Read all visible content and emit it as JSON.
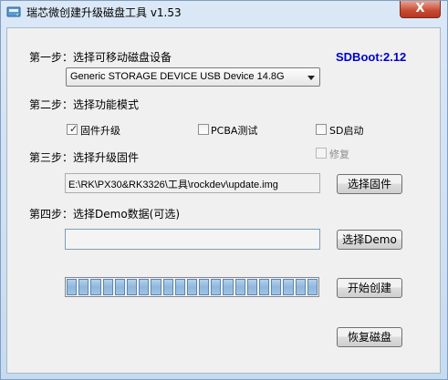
{
  "window": {
    "title": "瑞芯微创建升级磁盘工具 v1.53",
    "close_label": "X"
  },
  "version": "SDBoot:2.12",
  "step1": {
    "label": "第一步：选择可移动磁盘设备",
    "device": "Generic STORAGE DEVICE USB Device   14.8G"
  },
  "step2": {
    "label": "第二步：选择功能模式",
    "options": [
      {
        "label": "固件升级",
        "checked": true,
        "enabled": true
      },
      {
        "label": "PCBA测试",
        "checked": false,
        "enabled": true
      },
      {
        "label": "SD启动",
        "checked": false,
        "enabled": true
      },
      {
        "label": "修复",
        "checked": false,
        "enabled": false
      }
    ]
  },
  "step3": {
    "label": "第三步：选择升级固件",
    "path": "E:\\RK\\PX30&RK3326\\工具\\rockdev\\update.img",
    "button": "选择固件"
  },
  "step4": {
    "label": "第四步：选择Demo数据(可选)",
    "path": "",
    "button": "选择Demo"
  },
  "progress": {
    "fraction": 1.0,
    "segments": 21
  },
  "actions": {
    "create": "开始创建",
    "restore": "恢复磁盘"
  }
}
